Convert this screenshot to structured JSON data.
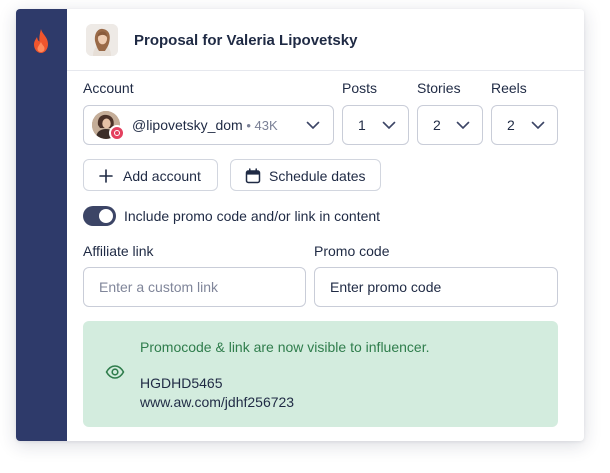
{
  "header": {
    "title": "Proposal for Valeria Lipovetsky"
  },
  "labels": {
    "account": "Account",
    "posts": "Posts",
    "stories": "Stories",
    "reels": "Reels",
    "affiliate_link": "Affiliate link",
    "promo_code": "Promo code"
  },
  "account_select": {
    "handle": "@lipovetsky_dom",
    "separator": " • ",
    "followers": "43K",
    "platform_icon": "instagram-icon"
  },
  "counts": {
    "posts": "1",
    "stories": "2",
    "reels": "2"
  },
  "buttons": {
    "add_account": "Add account",
    "schedule_dates": "Schedule dates"
  },
  "toggle": {
    "label": "Include promo code and/or link in content",
    "on": true
  },
  "inputs": {
    "affiliate_placeholder": "Enter a custom link",
    "promo_value": "Enter promo code"
  },
  "notice": {
    "message": "Promocode & link are now visible to influencer.",
    "code": "HGDHD5465",
    "link": "www.aw.com/jdhf256723"
  },
  "colors": {
    "sidebar": "#2e3a6a",
    "brand_flame": "#f0552c",
    "notice_bg": "#d3ecde",
    "notice_text": "#2f7d4c"
  }
}
